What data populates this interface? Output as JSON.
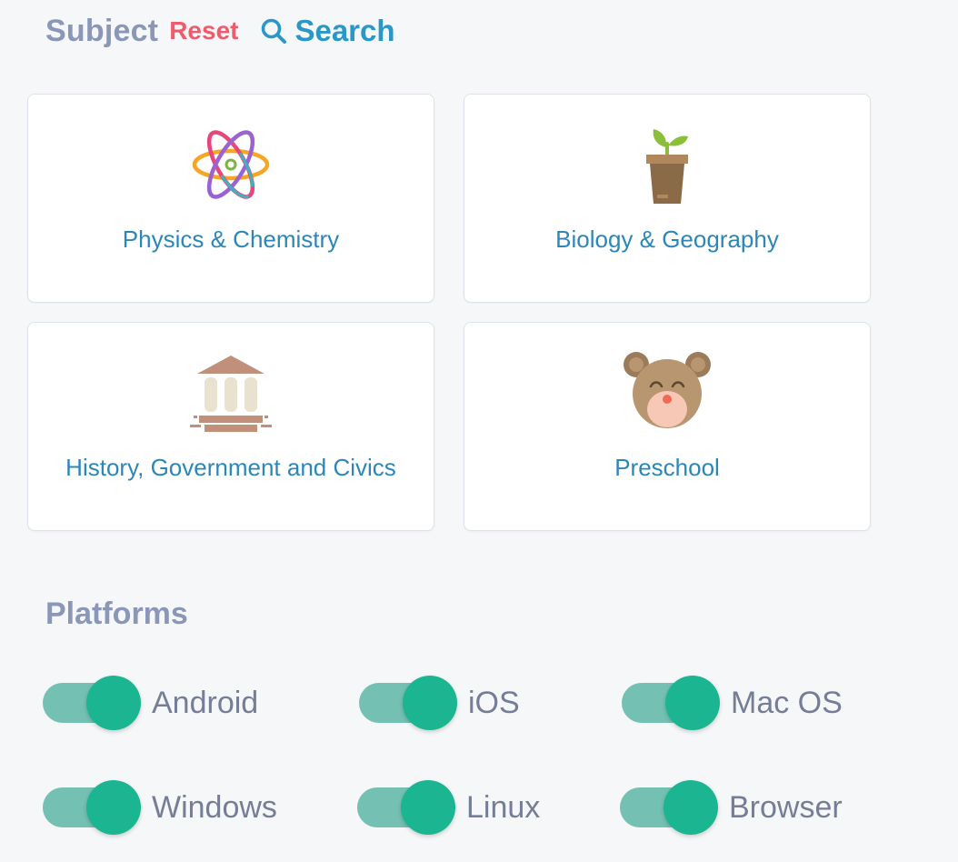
{
  "header": {
    "title": "Subject",
    "reset_label": "Reset",
    "search_label": "Search",
    "search_icon": "search-icon"
  },
  "subjects": [
    {
      "label": "Physics & Chemistry",
      "icon": "atom-icon"
    },
    {
      "label": "Biology & Geography",
      "icon": "plant-pot-icon"
    },
    {
      "label": "History, Government and Civics",
      "icon": "museum-icon"
    },
    {
      "label": "Preschool",
      "icon": "bear-icon"
    }
  ],
  "platforms": {
    "title": "Platforms",
    "items": [
      {
        "label": "Android",
        "enabled": true
      },
      {
        "label": "iOS",
        "enabled": true
      },
      {
        "label": "Mac OS",
        "enabled": true
      },
      {
        "label": "Windows",
        "enabled": true
      },
      {
        "label": "Linux",
        "enabled": true
      },
      {
        "label": "Browser",
        "enabled": true
      }
    ]
  },
  "colors": {
    "heading": "#8a97b8",
    "reset": "#ef5b6c",
    "search": "#2a97c9",
    "card_label": "#2b87b8",
    "toggle_track": "#74c0b3",
    "toggle_knob": "#1cb592",
    "toggle_label": "#757e96"
  }
}
